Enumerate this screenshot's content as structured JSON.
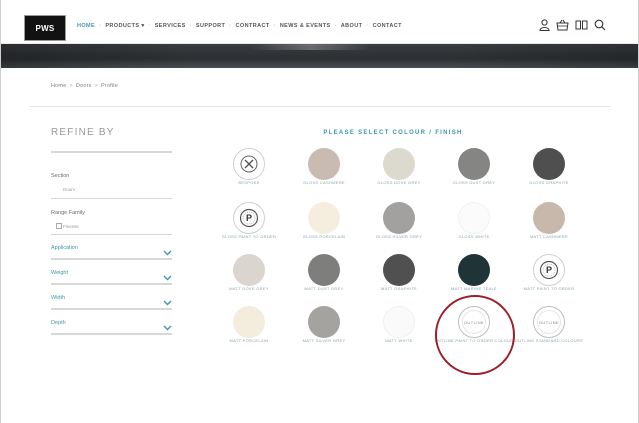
{
  "header": {
    "logo_text": "PWS",
    "nav": [
      {
        "label": "HOME",
        "active": true
      },
      {
        "label": "PRODUCTS ▾",
        "active": false
      },
      {
        "label": "SERVICES",
        "active": false
      },
      {
        "label": "SUPPORT",
        "active": false
      },
      {
        "label": "CONTRACT",
        "active": false
      },
      {
        "label": "NEWS & EVENTS",
        "active": false
      },
      {
        "label": "ABOUT",
        "active": false
      },
      {
        "label": "CONTACT",
        "active": false
      }
    ],
    "icons": [
      "user-icon",
      "basket-icon",
      "compare-icon",
      "search-icon"
    ]
  },
  "breadcrumb": [
    "Home",
    "Doors",
    "Profile"
  ],
  "sidebar": {
    "title": "REFINE BY",
    "section_label": "Section",
    "section_value": "Doors",
    "range_label": "Range Family",
    "range_value": "Finesse",
    "filters": [
      "Application",
      "Weight",
      "Width",
      "Depth"
    ]
  },
  "grid": {
    "title": "PLEASE SELECT COLOUR / FINISH",
    "swatches": [
      {
        "name": "BESPOKE",
        "color": "#ffffff",
        "kind": "bespoke"
      },
      {
        "name": "GLOSS CASHMERE",
        "color": "#c9bbb1",
        "kind": "solid"
      },
      {
        "name": "GLOSS DOVE GREY",
        "color": "#dcd9cf",
        "kind": "solid"
      },
      {
        "name": "GLOSS DUST GREY",
        "color": "#858583",
        "kind": "solid"
      },
      {
        "name": "GLOSS GRAPHITE",
        "color": "#4f4f4f",
        "kind": "solid"
      },
      {
        "name": "GLOSS PAINT TO ORDER",
        "color": "#ffffff",
        "kind": "paint"
      },
      {
        "name": "GLOSS PORCELAIN",
        "color": "#f5eedf",
        "kind": "solid"
      },
      {
        "name": "GLOSS SILVER GREY",
        "color": "#a3a1a0",
        "kind": "solid"
      },
      {
        "name": "GLOSS WHITE",
        "color": "#fbfbfb",
        "kind": "solid"
      },
      {
        "name": "MATT CASHMERE",
        "color": "#c7b8ab",
        "kind": "solid"
      },
      {
        "name": "MATT DOVE GREY",
        "color": "#dad6cf",
        "kind": "solid"
      },
      {
        "name": "MATT DUST GREY",
        "color": "#7e7e7c",
        "kind": "solid"
      },
      {
        "name": "MATT GRAPHITE",
        "color": "#505050",
        "kind": "solid"
      },
      {
        "name": "MATT MARINE TEALE",
        "color": "#1f3437",
        "kind": "solid"
      },
      {
        "name": "MATT PAINT TO ORDER",
        "color": "#ffffff",
        "kind": "paint"
      },
      {
        "name": "MATT PORCELAIN",
        "color": "#f4ecdd",
        "kind": "solid"
      },
      {
        "name": "MATT SILVER GREY",
        "color": "#a5a39f",
        "kind": "solid"
      },
      {
        "name": "MATT WHITE",
        "color": "#fafafa",
        "kind": "solid"
      },
      {
        "name": "OUTLINE PAINT TO ORDER COLOUR",
        "color": "#ffffff",
        "kind": "outline",
        "badge": "OUTLINE"
      },
      {
        "name": "OUTLINE STANDARD COLOURS",
        "color": "#ffffff",
        "kind": "outline",
        "badge": "OUTLINE"
      }
    ]
  },
  "colors": {
    "accent": "#3d97b1",
    "highlight_ring": "#9c1f2c"
  }
}
